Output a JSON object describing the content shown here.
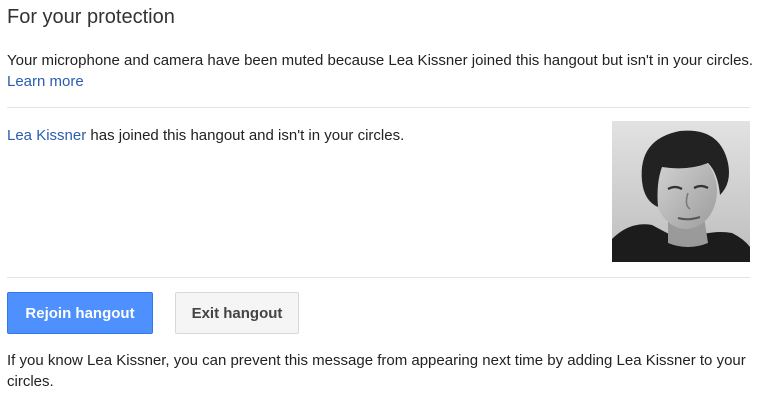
{
  "dialog": {
    "title": "For your protection",
    "intro_text": "Your microphone and camera have been muted because Lea Kissner joined this hangout but isn't in your circles. ",
    "learn_more_link": "Learn more",
    "joined_name": "Lea Kissner",
    "joined_text": " has joined this hangout and isn't in your circles.",
    "photo_icon": "user-photo",
    "buttons": {
      "rejoin_label": "Rejoin hangout",
      "exit_label": "Exit hangout"
    },
    "footnote_text": "If you know Lea Kissner, you can prevent this message from appearing next time by adding Lea Kissner to your circles."
  },
  "colors": {
    "link": "#2a5db0",
    "primary_button": "#4d90fe",
    "secondary_button": "#f5f5f5",
    "divider": "#e4e4e4"
  }
}
